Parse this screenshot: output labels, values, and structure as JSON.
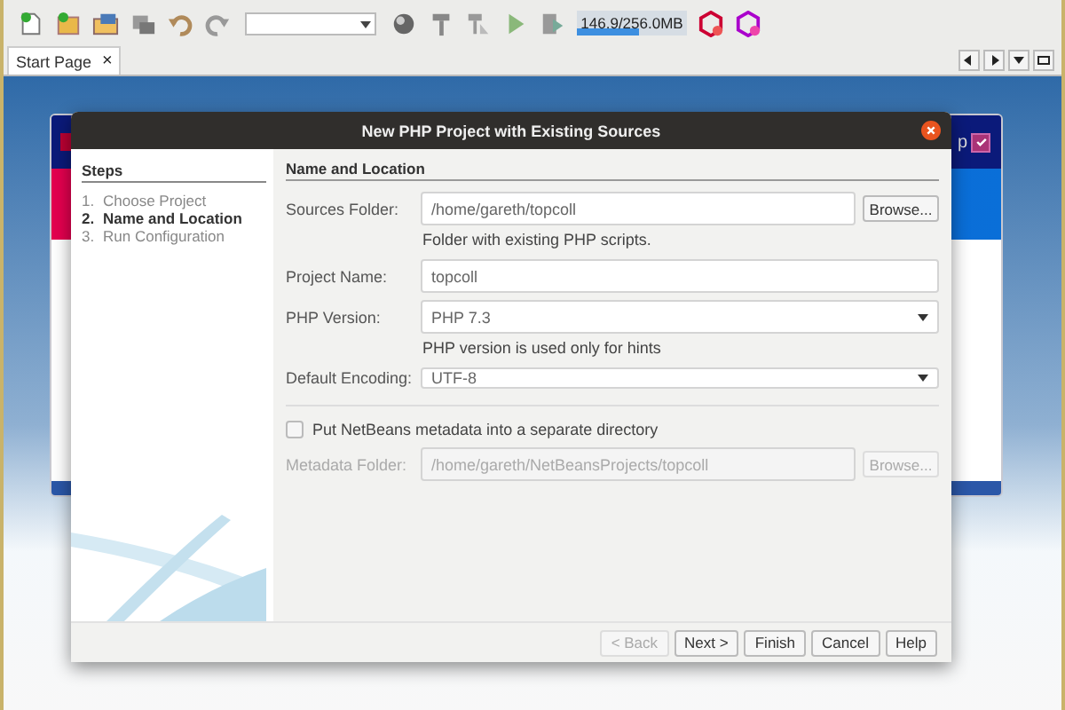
{
  "toolbar": {
    "memory": {
      "text": "146.9/256.0MB",
      "level": 0.57
    }
  },
  "tabs": [
    {
      "label": "Start Page",
      "close": "×",
      "selected": true
    }
  ],
  "start_page": {
    "fragment": "p",
    "checked": true
  },
  "dialog": {
    "title": "New PHP Project with Existing Sources",
    "steps_title": "Steps",
    "steps": [
      {
        "number": "1.",
        "label": "Choose Project",
        "selected": false
      },
      {
        "number": "2.",
        "label": "Name and Location",
        "selected": true
      },
      {
        "number": "3.",
        "label": "Run Configuration",
        "selected": false
      }
    ],
    "section_title": "Name and Location",
    "rows": [
      {
        "kind": "text",
        "label": "Sources Folder:",
        "value": "/home/gareth/topcoll",
        "button": "Browse...",
        "hint": "Folder with existing PHP scripts."
      },
      {
        "kind": "text",
        "label": "Project Name:",
        "value": "topcoll"
      },
      {
        "kind": "combo",
        "label": "PHP Version:",
        "value": "PHP 7.3",
        "hint": "PHP version is used only for hints"
      },
      {
        "kind": "select",
        "label": "Default Encoding:",
        "value": "UTF-8"
      }
    ],
    "metadata_checkbox": {
      "label": "Put NetBeans metadata into a separate directory",
      "checked": false
    },
    "metadata_row": {
      "label": "Metadata Folder:",
      "value": "/home/gareth/NetBeansProjects/topcoll",
      "button": "Browse...",
      "disabled": true
    },
    "buttons": [
      {
        "label": "< Back",
        "disabled": true
      },
      {
        "label": "Next >",
        "disabled": false
      },
      {
        "label": "Finish",
        "disabled": false
      },
      {
        "label": "Cancel",
        "disabled": false
      },
      {
        "label": "Help",
        "disabled": false
      }
    ]
  }
}
